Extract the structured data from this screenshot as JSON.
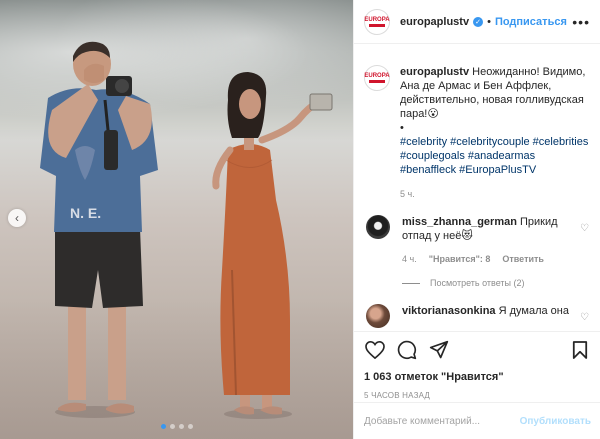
{
  "post": {
    "username": "europaplustv",
    "verified_icon": "verified-badge-icon",
    "separator": "•",
    "follow_label": "Подписаться",
    "more_icon": "more-options-icon",
    "logo_text": "EUROPA PLUS TV",
    "brand_color": "#d0142c"
  },
  "caption": {
    "username": "europaplustv",
    "text": "Неожиданно! Видимо, Ана де Армас и Бен Аффлек, действительно, новая голливудская пара!😮",
    "bullet": "•",
    "hashtags": "#celebrity #celebritycouple #celebrities #couplegoals #anadearmas #benaffleck #EuropaPlusTV",
    "time": "5 ч."
  },
  "comments": [
    {
      "username": "miss_zhanna_german",
      "text": "Прикид отпад у неё😻",
      "time": "4 ч.",
      "likes": "\"Нравится\": 8",
      "reply_label": "Ответить",
      "replies_label": "Посмотреть ответы (2)"
    },
    {
      "username": "viktorianasonkina",
      "text": "Я думала она"
    }
  ],
  "actions": {
    "likes": "1 063 отметок \"Нравится\"",
    "timestamp": "5 ЧАСОВ НАЗАД"
  },
  "add_comment": {
    "placeholder": "Добавьте комментарий...",
    "publish_label": "Опубликовать"
  },
  "carousel": {
    "prev_icon": "chevron-left-icon",
    "dot_count": 4,
    "active_dot": 0
  },
  "colors": {
    "accent": "#3897f0",
    "hashtag": "#003569"
  }
}
